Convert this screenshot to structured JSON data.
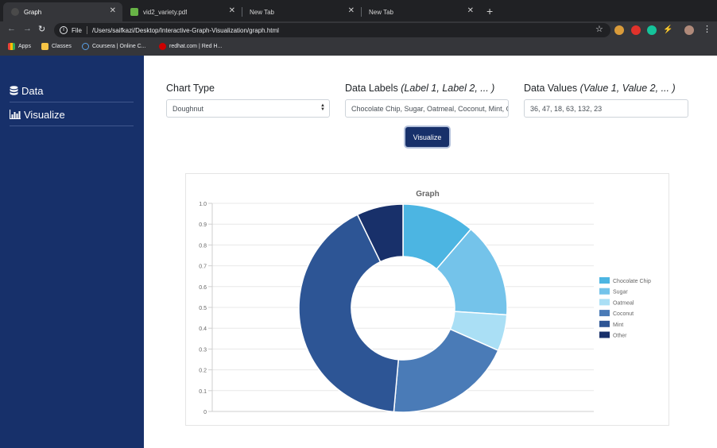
{
  "browser": {
    "tabs": [
      {
        "title": "Graph",
        "active": true
      },
      {
        "title": "vid2_variety.pdf",
        "active": false
      },
      {
        "title": "New Tab",
        "active": false
      },
      {
        "title": "New Tab",
        "active": false
      }
    ],
    "address": {
      "protocol": "File",
      "url": "/Users/saifkazi/Desktop/Interactive-Graph-Visualization/graph.html"
    },
    "bookmarks": [
      "Apps",
      "Classes",
      "Coursera | Online C...",
      "redhat.com | Red H..."
    ]
  },
  "sidebar": {
    "items": [
      {
        "label": "Data",
        "icon": "database-icon"
      },
      {
        "label": "Visualize",
        "icon": "bar-chart-icon"
      }
    ]
  },
  "form": {
    "chart_type_label": "Chart Type",
    "chart_type_value": "Doughnut",
    "data_labels_label": "Data Labels",
    "data_labels_hint": "(Label 1, Label 2, ... )",
    "data_labels_value": "Chocolate Chip, Sugar, Oatmeal, Coconut, Mint, Other",
    "data_values_label": "Data Values",
    "data_values_hint": "(Value 1, Value 2, ... )",
    "data_values_value": "36, 47, 18, 63, 132, 23",
    "visualize_button": "Visualize"
  },
  "chart_data": {
    "type": "doughnut",
    "title": "Graph",
    "categories": [
      "Chocolate Chip",
      "Sugar",
      "Oatmeal",
      "Coconut",
      "Mint",
      "Other"
    ],
    "values": [
      36,
      47,
      18,
      63,
      132,
      23
    ],
    "colors": [
      "#4cb5e2",
      "#74c3ea",
      "#aadff5",
      "#4a7bb7",
      "#2d5595",
      "#18306a"
    ],
    "yticks": [
      "0",
      "0.1",
      "0.2",
      "0.3",
      "0.4",
      "0.5",
      "0.6",
      "0.7",
      "0.8",
      "0.9",
      "1.0"
    ],
    "ylim": [
      0,
      1
    ],
    "grid": true,
    "legend_position": "right"
  }
}
